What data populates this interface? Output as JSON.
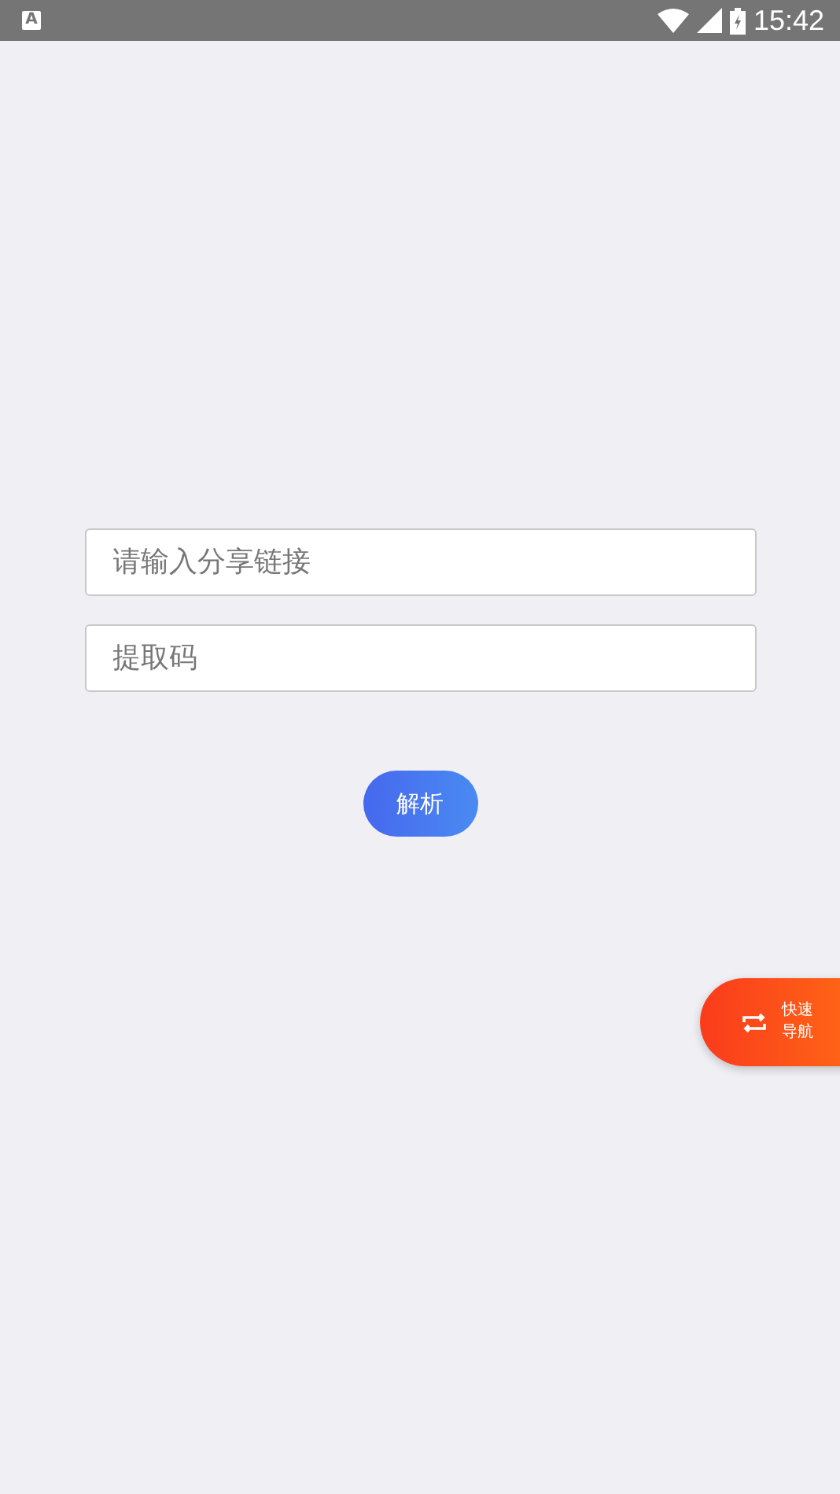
{
  "status_bar": {
    "notification": "A",
    "time": "15:42"
  },
  "form": {
    "link_field": {
      "placeholder": "请输入分享链接"
    },
    "code_field": {
      "placeholder": "提取码"
    },
    "submit": "解析"
  },
  "quick_nav": {
    "label_1": "快速",
    "label_2": "导航"
  }
}
